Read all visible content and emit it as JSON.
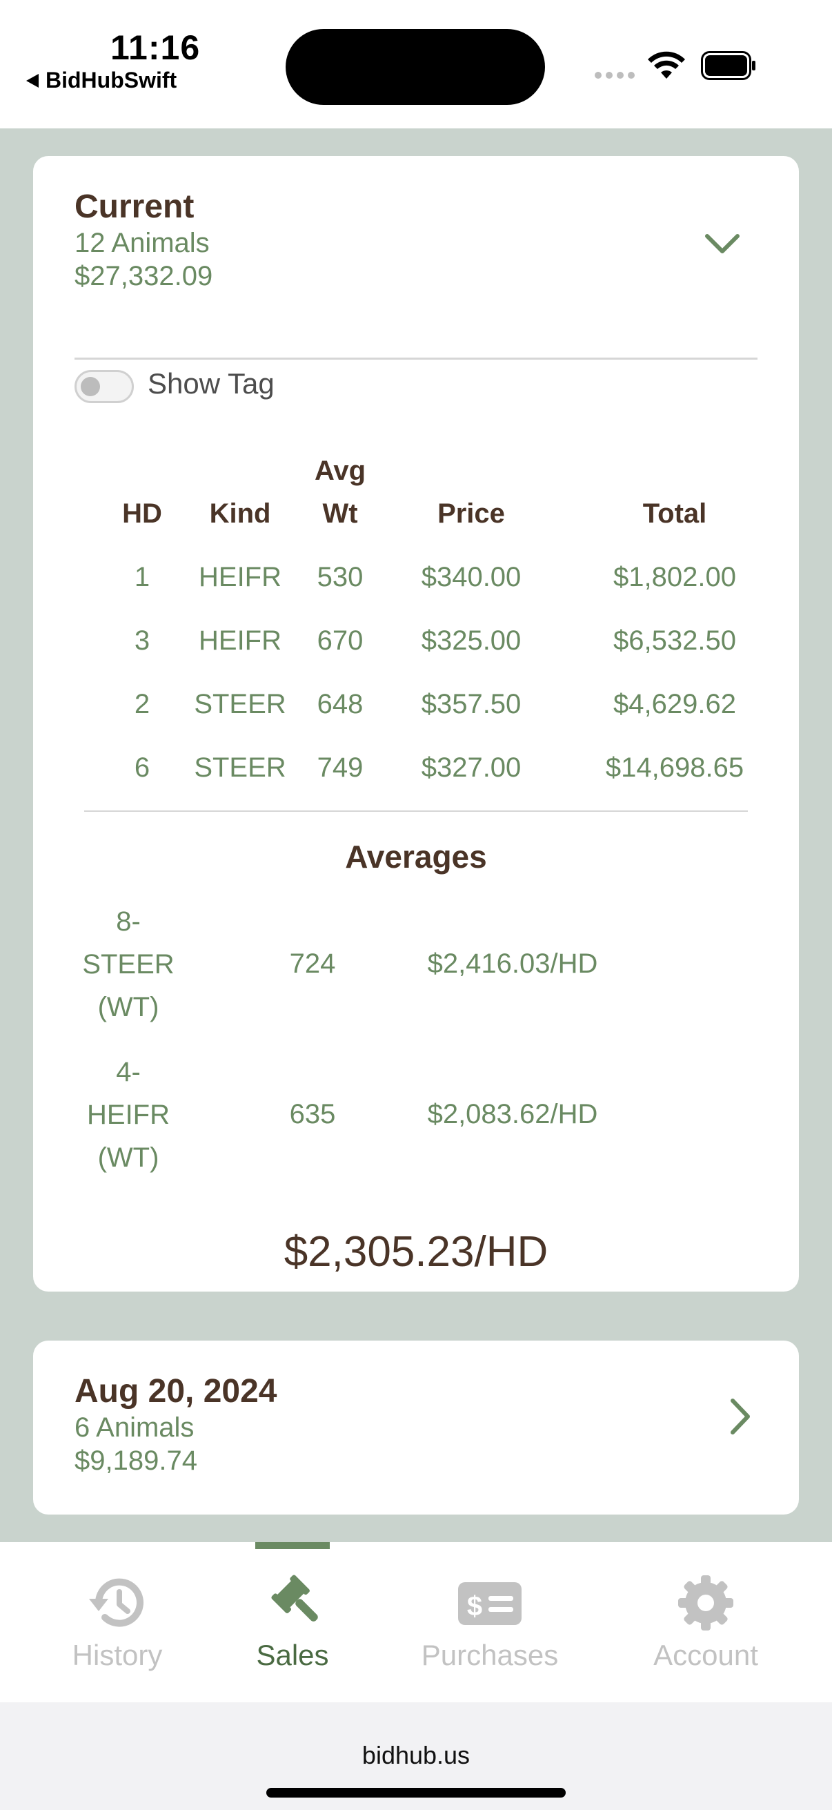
{
  "status_bar": {
    "time": "11:16",
    "back_app": "BidHubSwift"
  },
  "current": {
    "title": "Current",
    "animals": "12 Animals",
    "amount": "$27,332.09",
    "show_tag_label": "Show Tag",
    "show_tag_on": false,
    "headers": {
      "hd": "HD",
      "kind": "Kind",
      "avg_line1": "Avg",
      "avg_line2": "Wt",
      "price": "Price",
      "total": "Total"
    },
    "rows": [
      {
        "hd": "1",
        "kind": "HEIFR",
        "wt": "530",
        "price": "$340.00",
        "total": "$1,802.00"
      },
      {
        "hd": "3",
        "kind": "HEIFR",
        "wt": "670",
        "price": "$325.00",
        "total": "$6,532.50"
      },
      {
        "hd": "2",
        "kind": "STEER",
        "wt": "648",
        "price": "$357.50",
        "total": "$4,629.62"
      },
      {
        "hd": "6",
        "kind": "STEER",
        "wt": "749",
        "price": "$327.00",
        "total": "$14,698.65"
      }
    ],
    "averages_title": "Averages",
    "averages": [
      {
        "line1": "8-",
        "line2": "STEER",
        "line3": "(WT)",
        "wt": "724",
        "per_hd": "$2,416.03/HD"
      },
      {
        "line1": "4-",
        "line2": "HEIFR",
        "line3": "(WT)",
        "wt": "635",
        "per_hd": "$2,083.62/HD"
      }
    ],
    "grand_per_hd": "$2,305.23/HD"
  },
  "past_sale": {
    "date": "Aug 20, 2024",
    "animals": "6 Animals",
    "amount": "$9,189.74"
  },
  "tabs": [
    {
      "label": "History",
      "icon": "history-icon",
      "active": false
    },
    {
      "label": "Sales",
      "icon": "gavel-icon",
      "active": true
    },
    {
      "label": "Purchases",
      "icon": "bill-icon",
      "active": false
    },
    {
      "label": "Account",
      "icon": "gear-icon",
      "active": false
    }
  ],
  "browser": {
    "url": "bidhub.us"
  },
  "colors": {
    "brown": "#4a3427",
    "green": "#6a8a62",
    "background": "#c9d3cd"
  }
}
